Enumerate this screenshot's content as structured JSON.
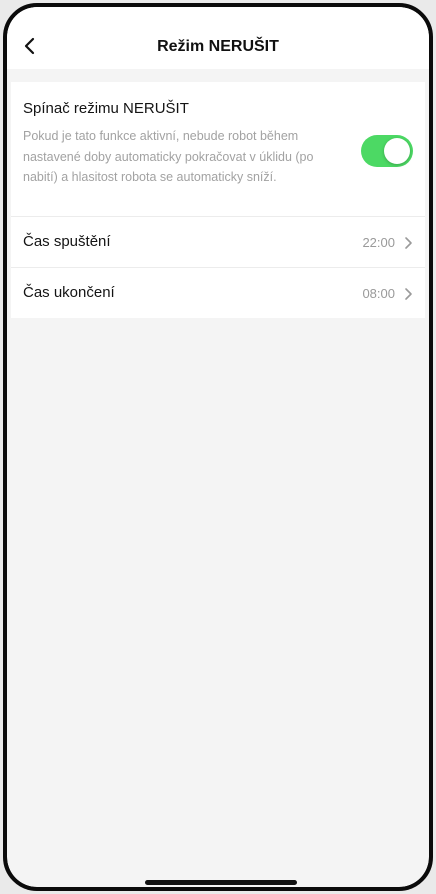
{
  "header": {
    "title": "Režim NERUŠIT",
    "back_icon": "chevron-left-icon"
  },
  "dnd": {
    "title": "Spínač režimu NERUŠIT",
    "description": "Pokud je tato funkce aktivní, nebude robot během nastavené doby automaticky pokračovat v úklidu (po nabití) a hlasitost robota se automaticky sníží.",
    "enabled": true,
    "toggle_color": "#4cd964"
  },
  "rows": {
    "start": {
      "label": "Čas spuštění",
      "value": "22:00",
      "icon": "chevron-right-icon"
    },
    "end": {
      "label": "Čas ukončení",
      "value": "08:00",
      "icon": "chevron-right-icon"
    }
  }
}
